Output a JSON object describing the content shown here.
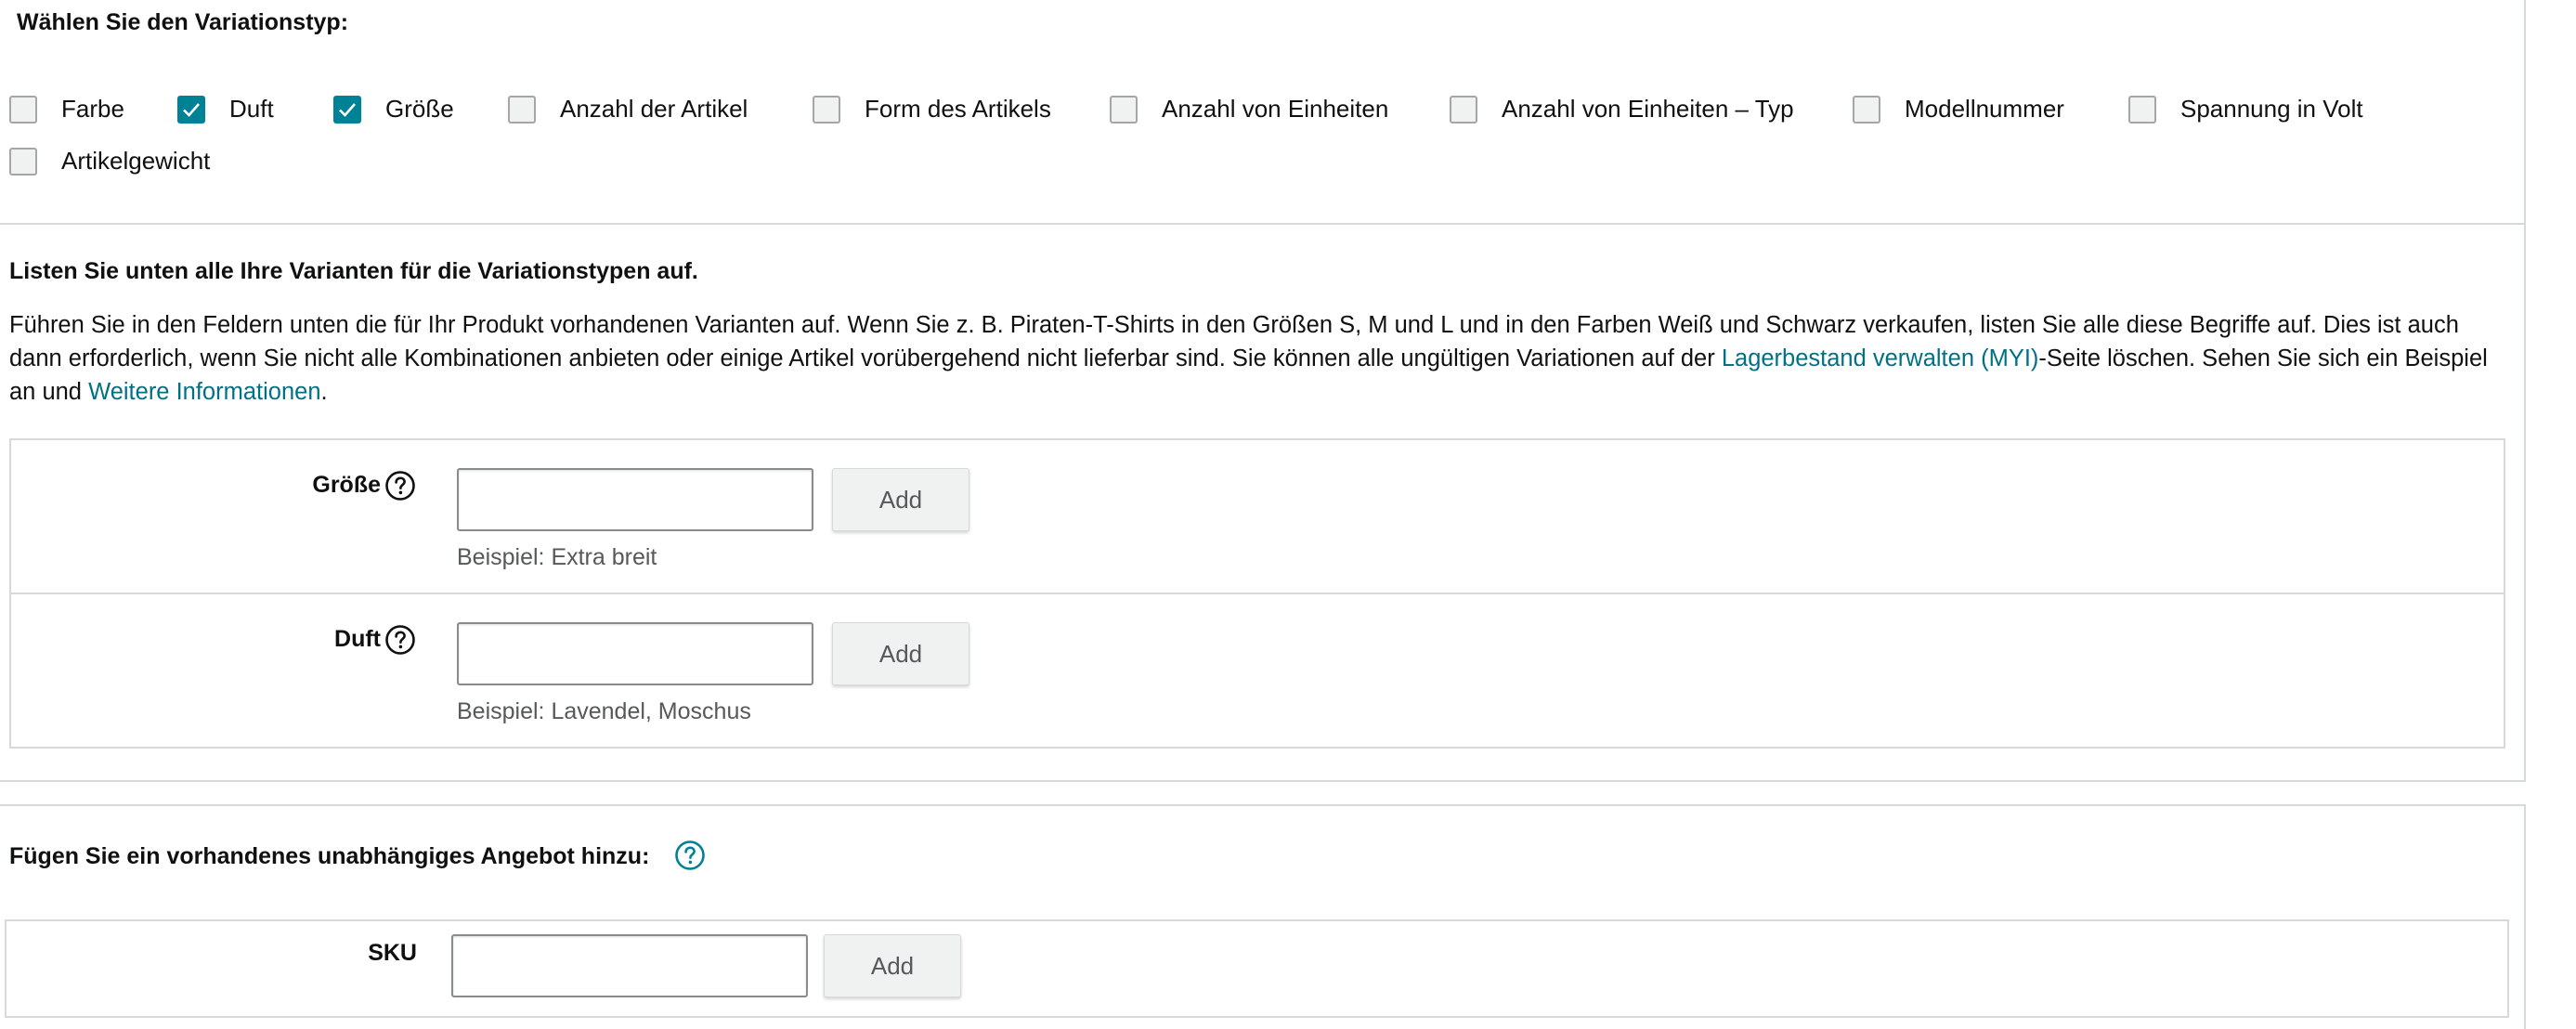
{
  "variation_type": {
    "title": "Wählen Sie den Variationstyp:",
    "options": [
      {
        "label": "Farbe",
        "checked": false
      },
      {
        "label": "Duft",
        "checked": true
      },
      {
        "label": "Größe",
        "checked": true
      },
      {
        "label": "Anzahl der Artikel",
        "checked": false
      },
      {
        "label": "Form des Artikels",
        "checked": false
      },
      {
        "label": "Anzahl von Einheiten",
        "checked": false
      },
      {
        "label": "Anzahl von Einheiten – Typ",
        "checked": false
      },
      {
        "label": "Modellnummer",
        "checked": false
      },
      {
        "label": "Spannung in Volt",
        "checked": false
      },
      {
        "label": "Artikelgewicht",
        "checked": false
      }
    ]
  },
  "variants": {
    "title": "Listen Sie unten alle Ihre Varianten für die Variationstypen auf.",
    "desc_part1": "Führen Sie in den Feldern unten die für Ihr Produkt vorhandenen Varianten auf. Wenn Sie z. B. Piraten-T-Shirts in den Größen S, M und L und in den Farben Weiß und Schwarz verkaufen, listen Sie alle diese Begriffe auf. Dies ist auch dann erforderlich, wenn Sie nicht alle Kombinationen anbieten oder einige Artikel vorübergehend nicht lieferbar sind. Sie können alle ungültigen Variationen auf der ",
    "link_myi": "Lagerbestand verwalten (MYI)",
    "desc_part2": "-Seite löschen. Sehen Sie sich ein Beispiel an und ",
    "link_more": "Weitere Informationen",
    "desc_part3": ".",
    "fields": [
      {
        "label": "Größe",
        "value": "",
        "add_label": "Add",
        "example": "Beispiel: Extra breit"
      },
      {
        "label": "Duft",
        "value": "",
        "add_label": "Add",
        "example": "Beispiel: Lavendel, Moschus"
      }
    ]
  },
  "offer": {
    "title": "Fügen Sie ein vorhandenes unabhängiges Angebot hinzu:",
    "sku_label": "SKU",
    "sku_value": "",
    "add_label": "Add"
  },
  "colors": {
    "accent": "#008296",
    "link": "#007185",
    "border": "#d5d9d9"
  }
}
